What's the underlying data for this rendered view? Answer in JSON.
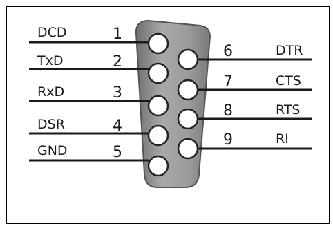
{
  "connector": {
    "left_column": [
      {
        "signal": "DCD",
        "pin": "1"
      },
      {
        "signal": "TxD",
        "pin": "2"
      },
      {
        "signal": "RxD",
        "pin": "3"
      },
      {
        "signal": "DSR",
        "pin": "4"
      },
      {
        "signal": "GND",
        "pin": "5"
      }
    ],
    "right_column": [
      {
        "signal": "DTR",
        "pin": "6"
      },
      {
        "signal": "CTS",
        "pin": "7"
      },
      {
        "signal": "RTS",
        "pin": "8"
      },
      {
        "signal": "RI",
        "pin": "9"
      }
    ]
  },
  "colors": {
    "frame": "#000000",
    "shell_fill": "#9a9a9a",
    "shell_stroke": "#555555",
    "pin_fill": "#ffffff",
    "wire": "#1a1a1a"
  }
}
